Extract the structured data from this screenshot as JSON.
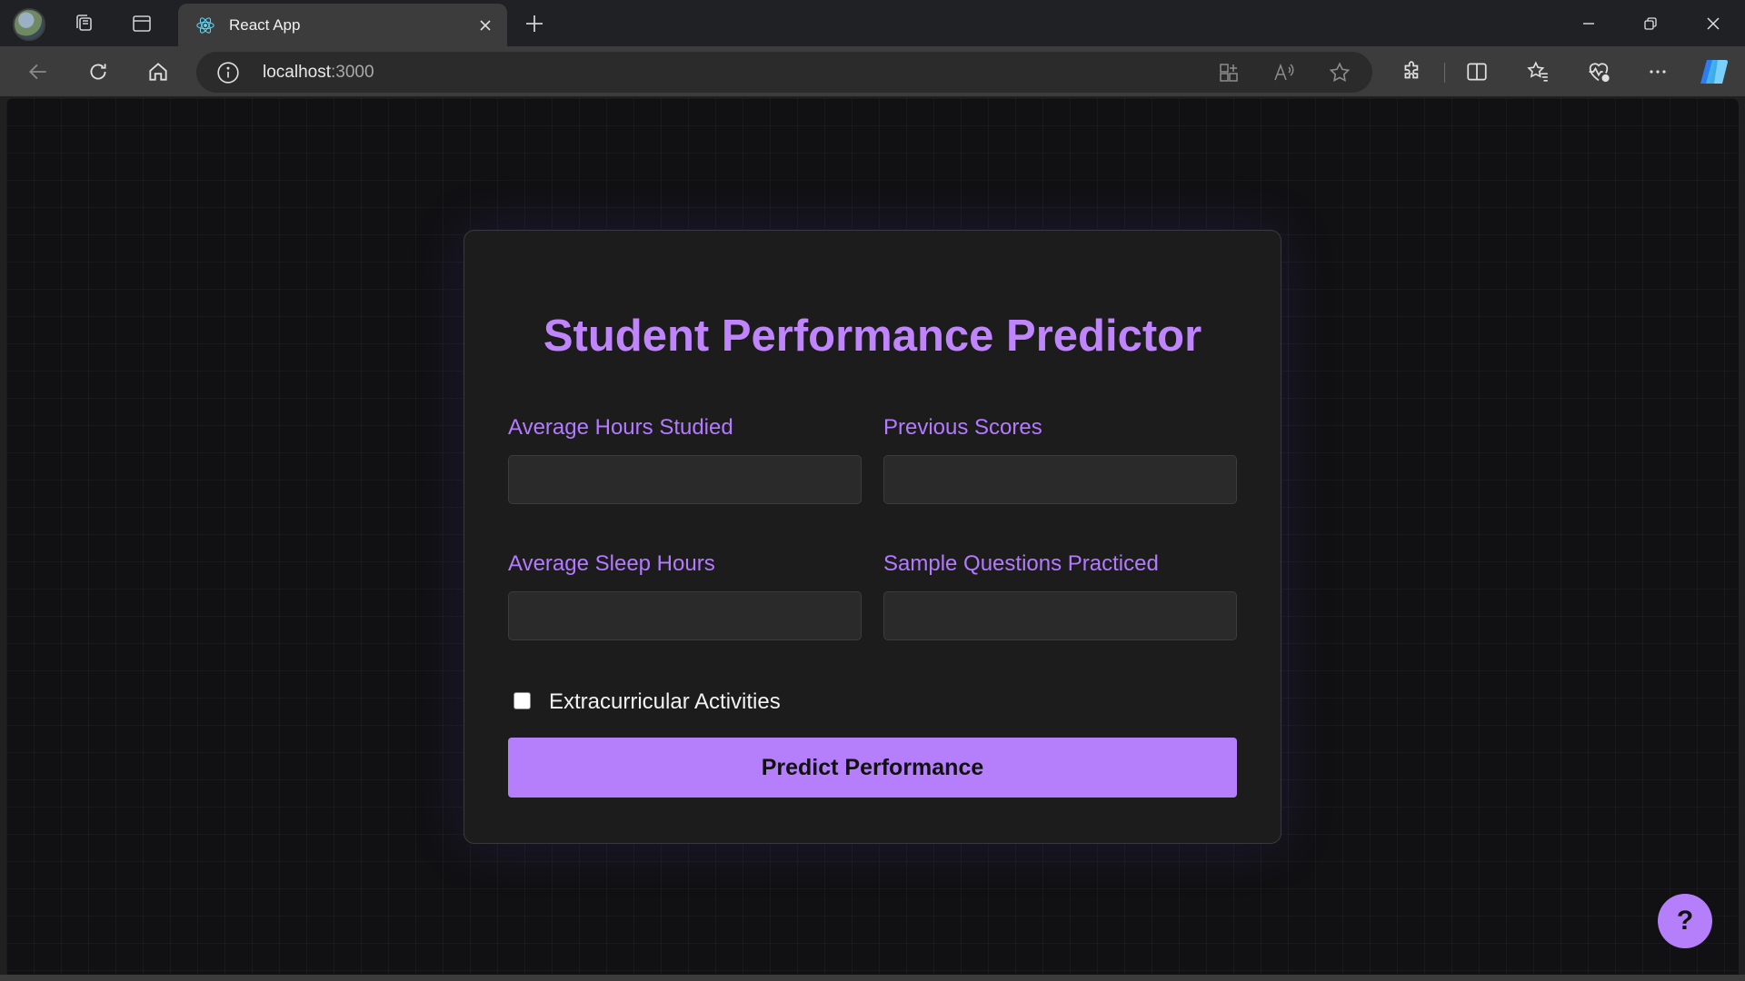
{
  "browser": {
    "tab": {
      "title": "React App"
    },
    "address_bar": {
      "host": "localhost",
      "port": ":3000"
    },
    "icons": {
      "workspaces": "workspaces-icon",
      "tab_actions": "tab-actions-icon",
      "favicon": "react-icon",
      "close_tab": "close-icon",
      "new_tab": "plus-icon",
      "minimize": "minimize-icon",
      "restore": "restore-icon",
      "close_window": "close-icon",
      "back": "back-arrow-icon",
      "refresh": "refresh-icon",
      "home": "home-icon",
      "site_info": "info-icon",
      "apps": "apps-icon",
      "read_aloud": "read-aloud-icon",
      "favorite": "star-icon",
      "extensions": "puzzle-icon",
      "split_screen": "split-screen-icon",
      "favorites": "favorites-icon",
      "browser_essentials": "heart-pulse-icon",
      "more": "more-icon",
      "copilot": "copilot-icon"
    }
  },
  "app": {
    "title": "Student Performance Predictor",
    "fields": {
      "hours_studied": {
        "label": "Average Hours Studied",
        "value": ""
      },
      "previous_scores": {
        "label": "Previous Scores",
        "value": ""
      },
      "sleep_hours": {
        "label": "Average Sleep Hours",
        "value": ""
      },
      "sample_questions": {
        "label": "Sample Questions Practiced",
        "value": ""
      }
    },
    "extracurricular": {
      "label": "Extracurricular Activities",
      "checked": false
    },
    "submit_label": "Predict Performance",
    "help_label": "?"
  },
  "colors": {
    "accent": "#b57ffb",
    "title": "#c084fc",
    "card_bg": "#1c1c1d",
    "page_bg": "#111113"
  }
}
